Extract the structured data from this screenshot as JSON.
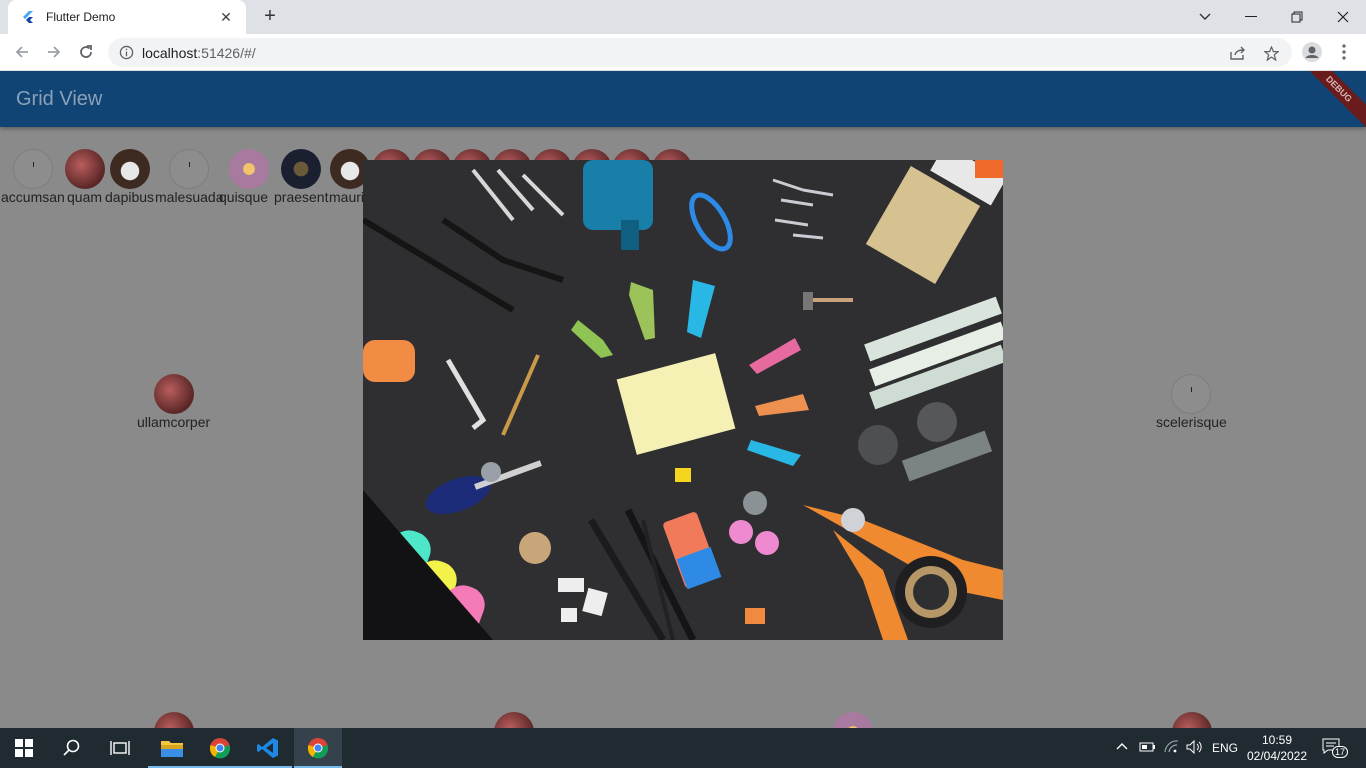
{
  "browser": {
    "tab_title": "Flutter Demo",
    "url_host": "localhost",
    "url_path": ":51426/#/"
  },
  "app": {
    "title": "Grid View",
    "debug_banner": "DEBUG"
  },
  "grid_top_row": [
    {
      "label": "accumsan",
      "icon": "clock"
    },
    {
      "label": "quam",
      "icon": "red-pattern"
    },
    {
      "label": "dapibus",
      "icon": "coffee-cup"
    },
    {
      "label": "malesuada",
      "icon": "clock"
    },
    {
      "label": "quisque",
      "icon": "banana-purple"
    },
    {
      "label": "praesent",
      "icon": "circuit"
    },
    {
      "label": "mauri",
      "icon": "coffee-cup"
    }
  ],
  "grid_mid_row": [
    {
      "label": "ullamcorper",
      "icon": "red-pattern"
    },
    {
      "label": "scelerisque",
      "icon": "clock"
    }
  ],
  "image_description_icon": "tools-flatlay-image",
  "taskbar": {
    "language": "ENG",
    "time": "10:59",
    "date": "02/04/2022",
    "notifications": "17"
  },
  "colors": {
    "appbar": "#0f4474",
    "scrim": "#8a8a8a",
    "taskbar": "#1f2a31"
  }
}
